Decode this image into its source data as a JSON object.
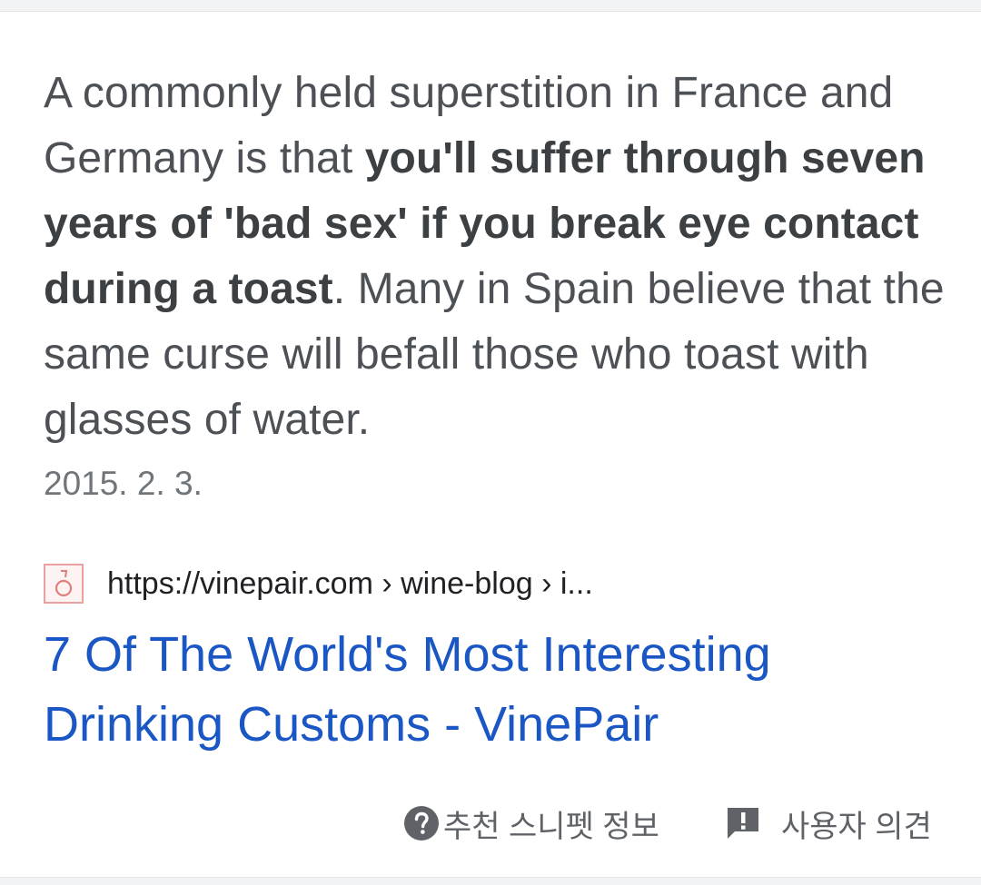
{
  "snippet": {
    "text_before": "A commonly held superstition in France and Germany is that ",
    "text_bold": "you'll suffer through seven years of 'bad sex' if you break eye contact during a toast",
    "text_after": ". Many in Spain believe that the same curse will befall those who toast with glasses of water.",
    "date": "2015. 2. 3."
  },
  "result": {
    "url": "https://vinepair.com › wine-blog › i...",
    "favicon": "vinepair-favicon",
    "title": "7 Of The World's Most Interesting Drinking Customs - VinePair",
    "title_color": "#1a56c4"
  },
  "footer": {
    "about_label": "추천 스니펫 정보",
    "about_icon": "help-circle-icon",
    "feedback_label": "사용자 의견",
    "feedback_icon": "feedback-icon"
  }
}
